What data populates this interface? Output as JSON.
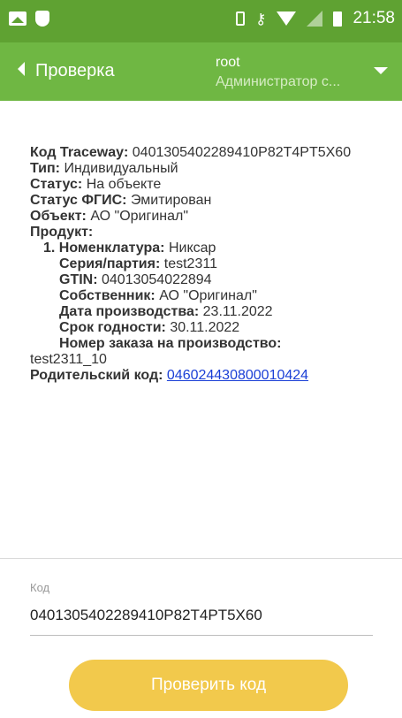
{
  "status_bar": {
    "time": "21:58"
  },
  "app_bar": {
    "title": "Проверка",
    "user": "root",
    "role": "Администратор с..."
  },
  "details": {
    "traceway_label": "Код Traceway:",
    "traceway_value": "0401305402289410P82T4PT5X60",
    "type_label": "Тип:",
    "type_value": "Индивидуальный",
    "status_label": "Статус:",
    "status_value": "На объекте",
    "fgis_label": "Статус ФГИС:",
    "fgis_value": "Эмитирован",
    "object_label": "Объект:",
    "object_value": "АО \"Оригинал\"",
    "product_label": "Продукт:",
    "nomenclature_label": "1. Номенклатура:",
    "nomenclature_value": "Никсар",
    "series_label": "Серия/партия:",
    "series_value": "test2311",
    "gtin_label": "GTIN:",
    "gtin_value": "04013054022894",
    "owner_label": "Собственник:",
    "owner_value": "АО \"Оригинал\"",
    "prod_date_label": "Дата производства:",
    "prod_date_value": "23.11.2022",
    "expiry_label": "Срок годности:",
    "expiry_value": "30.11.2022",
    "order_label": "Номер заказа на производство:",
    "order_value": "test2311_10",
    "parent_label": "Родительский код:",
    "parent_value": "046024430800010424"
  },
  "code_field": {
    "label": "Код",
    "value": "0401305402289410P82T4PT5X60"
  },
  "check_button": {
    "label": "Проверить код"
  }
}
